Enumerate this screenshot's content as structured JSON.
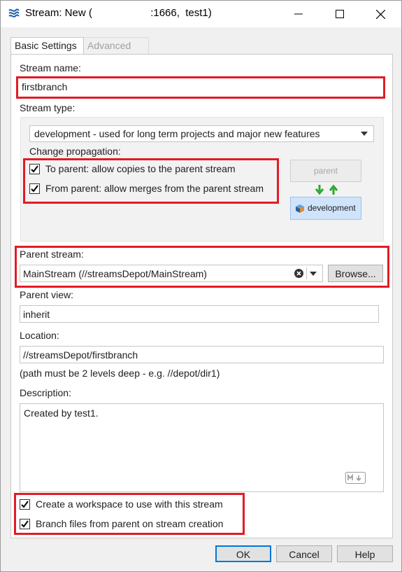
{
  "window": {
    "title": "Stream: New (                    :1666,  test1)",
    "minimize_icon": "minimize-icon",
    "maximize_icon": "maximize-icon",
    "close_icon": "close-icon"
  },
  "tabs": [
    {
      "label": "Basic Settings",
      "active": true
    },
    {
      "label": "Advanced",
      "active": false
    }
  ],
  "stream_name": {
    "label": "Stream name:",
    "value": "firstbranch"
  },
  "stream_type": {
    "label": "Stream type:",
    "selected": "development - used for long term projects and major new features",
    "change_propagation_label": "Change propagation:",
    "to_parent": {
      "label": "To parent: allow copies to the parent stream",
      "checked": true
    },
    "from_parent": {
      "label": "From parent: allow merges from the parent stream",
      "checked": true
    },
    "diagram": {
      "parent_label": "parent",
      "child_label": "development"
    }
  },
  "parent_stream": {
    "label": "Parent stream:",
    "value": "MainStream (//streamsDepot/MainStream)",
    "browse_label": "Browse..."
  },
  "parent_view": {
    "label": "Parent view:",
    "value": "inherit"
  },
  "location": {
    "label": "Location:",
    "value": "//streamsDepot/firstbranch",
    "hint": "(path must be 2 levels deep - e.g. //depot/dir1)"
  },
  "description": {
    "label": "Description:",
    "value": "Created by test1.",
    "markdown_icon": "markdown-icon"
  },
  "create_workspace": {
    "label": "Create a workspace to use with this stream",
    "checked": true
  },
  "branch_files": {
    "label": "Branch files from parent on stream creation",
    "checked": true
  },
  "buttons": {
    "ok": "OK",
    "cancel": "Cancel",
    "help": "Help"
  },
  "colors": {
    "highlight": "#e31b23",
    "accent": "#0078d7",
    "arrow": "#2ea82e"
  }
}
